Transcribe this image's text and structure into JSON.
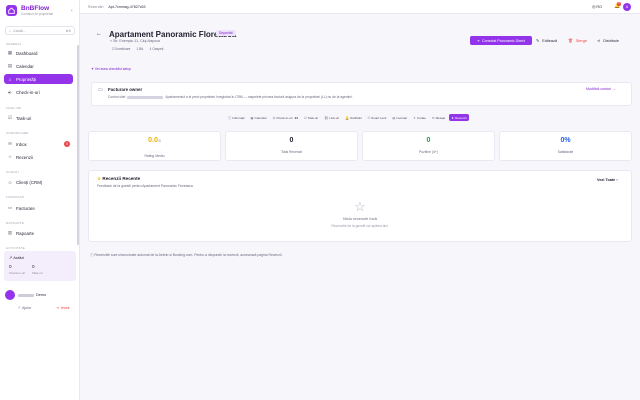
{
  "sidebar": {
    "brand_name": "BnBFlow",
    "brand_sub": "Comanzi de proprietari",
    "search_placeholder": "Caută...",
    "search_kbd": "⌘K",
    "sections": {
      "general": "GENERAL",
      "tasks": "TASK-URI",
      "comms": "COMUNICARE",
      "clients": "CLIENȚI",
      "finance": "FINANCIAR",
      "reports": "RAPOARTE",
      "activity": "ACTIVITATE"
    },
    "items": {
      "dashboard": "Dashboard",
      "calendar": "Calendar",
      "properties": "Proprietăți",
      "checkin": "Check-in-uri",
      "tasks": "Task-uri",
      "inbox": "Inbox",
      "inbox_count": "5",
      "reviews": "Recenzii",
      "crm": "Clienți (CRM)",
      "invoices": "Facturare",
      "reports": "Rapoarte"
    },
    "activity": {
      "title": "Astăzi",
      "checkin_value": "0",
      "checkin_label": "Check-in-uri",
      "tasks_value": "0",
      "tasks_label": "Task-uri"
    },
    "user_name": "Demo",
    "help_label": "Ajutor",
    "logout_label": "Ieșire"
  },
  "topbar": {
    "crumb_root": "Rezervări",
    "crumb_current": "Apt-7cmmsg-47827c53",
    "lang": "RO",
    "notif_count": "9",
    "avatar_letter": "A"
  },
  "property": {
    "title": "Apartament Panoramic Floreasca",
    "status": "Disponibil",
    "location": "Str. Exemplu 11, Cluj-Napoca",
    "meta": [
      "2 Dormitoare",
      "1 Bă.",
      "4 Oaspeți"
    ],
    "primary_action": "Conectat Panoramic Direct",
    "edit": "Editează",
    "delete": "Șterge",
    "share": "Distribuie"
  },
  "hint": "Vei avea checklist setup",
  "einvoice": {
    "title": "Facturare owner",
    "desc_before": "Conturi cliet",
    "desc_after": "Apartamentul a ei prezi proprietari înregistrat în CRM — raspelete prinnea factură asigura de la proprietari (LL) nu de la agenției.",
    "modify": "Modifică conturi →"
  },
  "tabs": [
    {
      "label": "Informații",
      "icon": "ⓘ"
    },
    {
      "label": "Calendar",
      "icon": "▦"
    },
    {
      "label": "Check-in-uri",
      "icon": "⎆",
      "count": "14"
    },
    {
      "label": "Task-uri",
      "icon": "☑"
    },
    {
      "label": "Link-uri",
      "icon": "⛓"
    },
    {
      "label": "Notificări",
      "icon": "🔔"
    },
    {
      "label": "Smart Lock",
      "icon": "⚿"
    },
    {
      "label": "Inventar",
      "icon": "▤"
    },
    {
      "label": "Curate",
      "icon": "✦"
    },
    {
      "label": "Mesaje",
      "icon": "✉"
    },
    {
      "label": "Recenzii",
      "icon": "★"
    }
  ],
  "stats": [
    {
      "value": "0.0",
      "suffix": "/5",
      "label": "Rating Mediu",
      "color": "#eab308"
    },
    {
      "value": "0",
      "label": "Total Recenzii",
      "color": "#1f1d2b"
    },
    {
      "value": "0",
      "label": "Pozitive (4+)",
      "color": "#16a34a"
    },
    {
      "value": "0%",
      "label": "Satisfacție",
      "color": "#2563eb"
    }
  ],
  "reviews": {
    "title": "Recenzii Recente",
    "subtitle": "Feedback de la guestii pentru Apartament Panoramic Floreasca",
    "view_all": "Vezi Toate",
    "empty_title": "Nicio recenzie încă",
    "empty_sub": "Recenziile de la guestii vor apărea aici."
  },
  "note": "Recenziile sunt sincronizate automat de la Airbnb și Booking.com. Pentru a răspunde la recenzii, accesează pagina Recenzii.",
  "colors": {
    "accent": "#9333ea",
    "danger": "#ef4444"
  }
}
